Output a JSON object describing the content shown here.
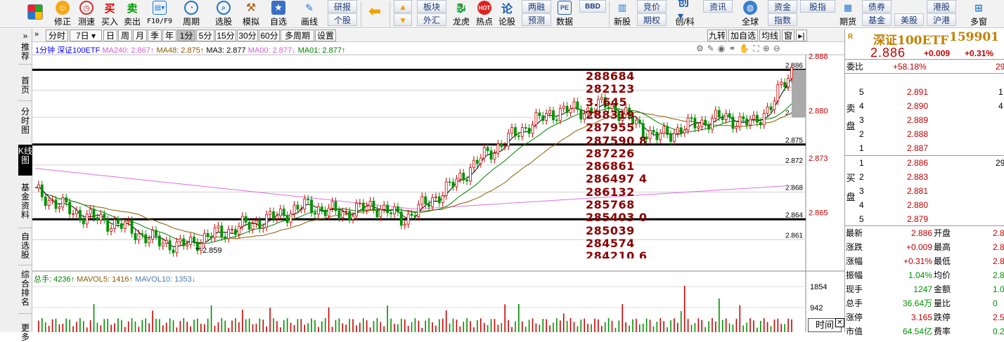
{
  "toolbar": {
    "buttons": [
      {
        "label": "",
        "icon": "windows-logo-icon"
      },
      {
        "label": "修正",
        "icon": "smiley-icon"
      },
      {
        "label": "测速",
        "icon": "clock-icon"
      },
      {
        "label": "买入",
        "icon": "buy-icon",
        "glyph": "买"
      },
      {
        "label": "卖出",
        "icon": "sell-icon",
        "glyph": "卖"
      },
      {
        "label": "F10/F9",
        "icon": "f10-icon"
      },
      {
        "label": "周期",
        "icon": "period-clock-icon"
      },
      {
        "label": "选股",
        "icon": "magnifier-icon"
      },
      {
        "label": "模拟",
        "icon": "hammer-icon"
      },
      {
        "label": "自选",
        "icon": "star-icon"
      },
      {
        "label": "画线",
        "icon": "pencil-icon"
      }
    ],
    "mini": {
      "yanbao": "研报",
      "gegu": "个股",
      "bankuai": "板块",
      "waihui": "外汇",
      "longhu": "龙虎",
      "redian": "热点",
      "lunbao": "论股",
      "liangrong": "两融",
      "yuce": "预测",
      "pe_data": "数据",
      "bbd": "BBD",
      "xinpai": "新股",
      "jingjia": "竞价",
      "qiquan": "期权",
      "chuangke": "创/科",
      "zixun": "资讯",
      "quanqiu": "全球",
      "zijin": "资金",
      "zhishu": "指数",
      "gupiao": "股指",
      "jijin": "基金",
      "zhaiquan": "债券",
      "meigu": "美股",
      "ganggu": "港股",
      "hugang": "沪港",
      "qihuo": "期货",
      "duorong": "多窗"
    }
  },
  "vtabs": [
    "推荐",
    "首页",
    "分时图",
    "K线图",
    "基金资料",
    "自选股",
    "综合排名",
    "更多"
  ],
  "period_bar": {
    "buttons": [
      "分时",
      "7日",
      "日",
      "周",
      "月",
      "季",
      "年",
      "1分",
      "5分",
      "15分",
      "30分",
      "60分",
      "多周期",
      "设置"
    ],
    "active": "1分",
    "right_buttons": [
      "九转",
      "加自选",
      "均线",
      "窗"
    ]
  },
  "chart": {
    "legend_main": [
      {
        "text": "1分钟",
        "color": "#0000ff"
      },
      {
        "text": "深证100ETF",
        "color": "#0000ff"
      },
      {
        "text": "MA240: 2.867↑",
        "color": "#d060d0"
      },
      {
        "text": "MA48: 2.875↑",
        "color": "#8b5a00"
      },
      {
        "text": "MA3: 2.877",
        "color": "#000000"
      },
      {
        "text": "MA00: 2.877↓",
        "color": "#d060d0"
      },
      {
        "text": "MA01: 2.877↑",
        "color": "#008000"
      }
    ],
    "price_axis": [
      "2.888",
      "2.883",
      "2.880",
      "2.879",
      "2.875",
      "2.873",
      "2.872",
      "2.868",
      "2.865",
      "2.864",
      "2.861"
    ],
    "right_axis_red": [
      "2.888",
      "2.880",
      "2.873",
      "2.865"
    ],
    "right_axis_black": [
      "2.886",
      "2.883",
      "2.879",
      "2.875",
      "2.872",
      "2.868",
      "2.864",
      "2.861"
    ],
    "low_label": "2.859",
    "overlay_numbers": [
      "288684",
      "282123",
      "3. 645",
      "288319",
      "287955",
      "287590  8",
      "287226",
      "286861",
      "286497  4",
      "286132",
      "285768",
      "285403  0",
      "285039",
      "284574",
      "284210  6"
    ],
    "volume_legend": [
      {
        "text": "总手: 4236↑",
        "color": "#008000"
      },
      {
        "text": "MAVOL5: 1416↑",
        "color": "#8b5a00"
      },
      {
        "text": "MAVOL10: 1353↓",
        "color": "#4a7ab5"
      }
    ],
    "vol_axis": [
      "1854",
      "942"
    ],
    "time_label": "时间"
  },
  "quote": {
    "name": "深证100ETF",
    "code": "159901",
    "price": "2.886",
    "change": "+0.009",
    "change_pct": "+0.31%",
    "weibi_label": "委比",
    "weibi": "+58.18%",
    "weicha_partial": "29",
    "sell_label": [
      "卖",
      "盘"
    ],
    "buy_label": [
      "买",
      "盘"
    ],
    "sells": [
      {
        "n": "5",
        "p": "2.891",
        "v": "1"
      },
      {
        "n": "4",
        "p": "2.890",
        "v": "4"
      },
      {
        "n": "3",
        "p": "2.889",
        "v": ""
      },
      {
        "n": "2",
        "p": "2.888",
        "v": ""
      },
      {
        "n": "1",
        "p": "2.887",
        "v": ""
      }
    ],
    "buys": [
      {
        "n": "1",
        "p": "2.886",
        "v": "29"
      },
      {
        "n": "2",
        "p": "2.883",
        "v": ""
      },
      {
        "n": "3",
        "p": "2.881",
        "v": ""
      },
      {
        "n": "4",
        "p": "2.880",
        "v": ""
      },
      {
        "n": "5",
        "p": "2.879",
        "v": ""
      }
    ],
    "stats": [
      {
        "l": "最新",
        "v": "2.886",
        "vc": "red",
        "l2": "开盘",
        "v2": "2.8"
      },
      {
        "l": "涨跌",
        "v": "+0.009",
        "vc": "red",
        "l2": "最高",
        "v2": "2.8"
      },
      {
        "l": "涨幅",
        "v": "+0.31%",
        "vc": "red",
        "l2": "最低",
        "v2": "2.8"
      },
      {
        "l": "振幅",
        "v": "1.04%",
        "vc": "green",
        "l2": "均价",
        "v2": "2.8"
      },
      {
        "l": "现手",
        "v": "1247",
        "vc": "green",
        "l2": "金额",
        "v2": "1.0"
      },
      {
        "l": "总手",
        "v": "36.64万",
        "vc": "green",
        "l2": "量比",
        "v2": "0"
      },
      {
        "l": "涨停",
        "v": "3.165",
        "vc": "red",
        "l2": "跌停",
        "v2": "2.5"
      },
      {
        "l": "市值",
        "v": "64.54亿",
        "vc": "green",
        "l2": "费率",
        "v2": "0.2"
      }
    ]
  }
}
